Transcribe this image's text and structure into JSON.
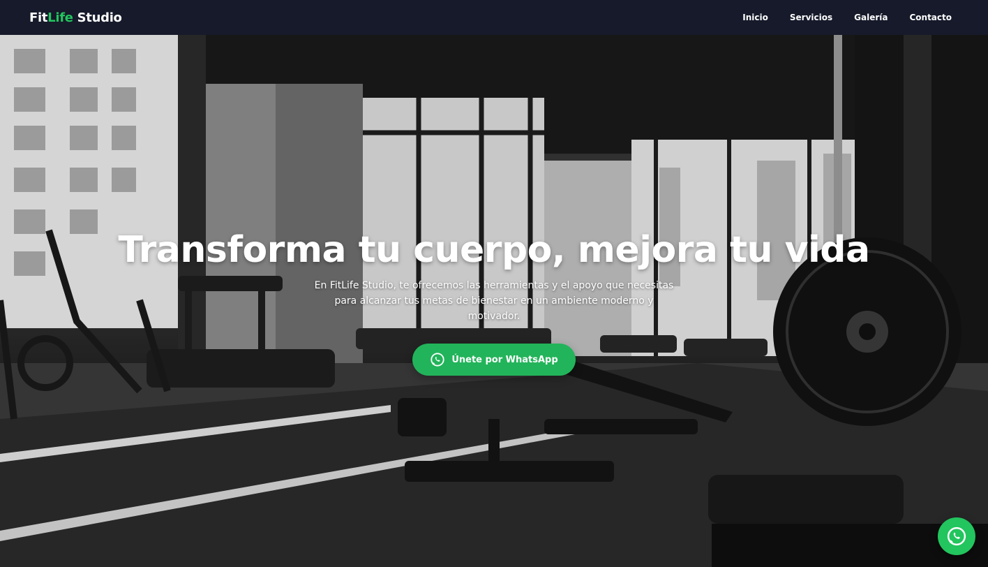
{
  "nav": {
    "brand_prefix": "Fit",
    "brand_accent": "Life",
    "brand_suffix": " Studio",
    "links": [
      {
        "label": "Inicio"
      },
      {
        "label": "Servicios"
      },
      {
        "label": "Galería"
      },
      {
        "label": "Contacto"
      }
    ]
  },
  "hero": {
    "title": "Transforma tu cuerpo, mejora tu vida",
    "subtitle": "En FitLife Studio, te ofrecemos las herramientas y el apoyo que necesitas para alcanzar tus metas de bienestar en un ambiente moderno y motivador.",
    "cta_label": "Únete por WhatsApp",
    "cta_icon": "whatsapp-icon",
    "background": "gym-interior-photo"
  },
  "floating_button": {
    "icon": "whatsapp-icon"
  },
  "colors": {
    "accent": "#22c55e",
    "navbar_bg": "#161a2a",
    "text": "#ffffff"
  }
}
